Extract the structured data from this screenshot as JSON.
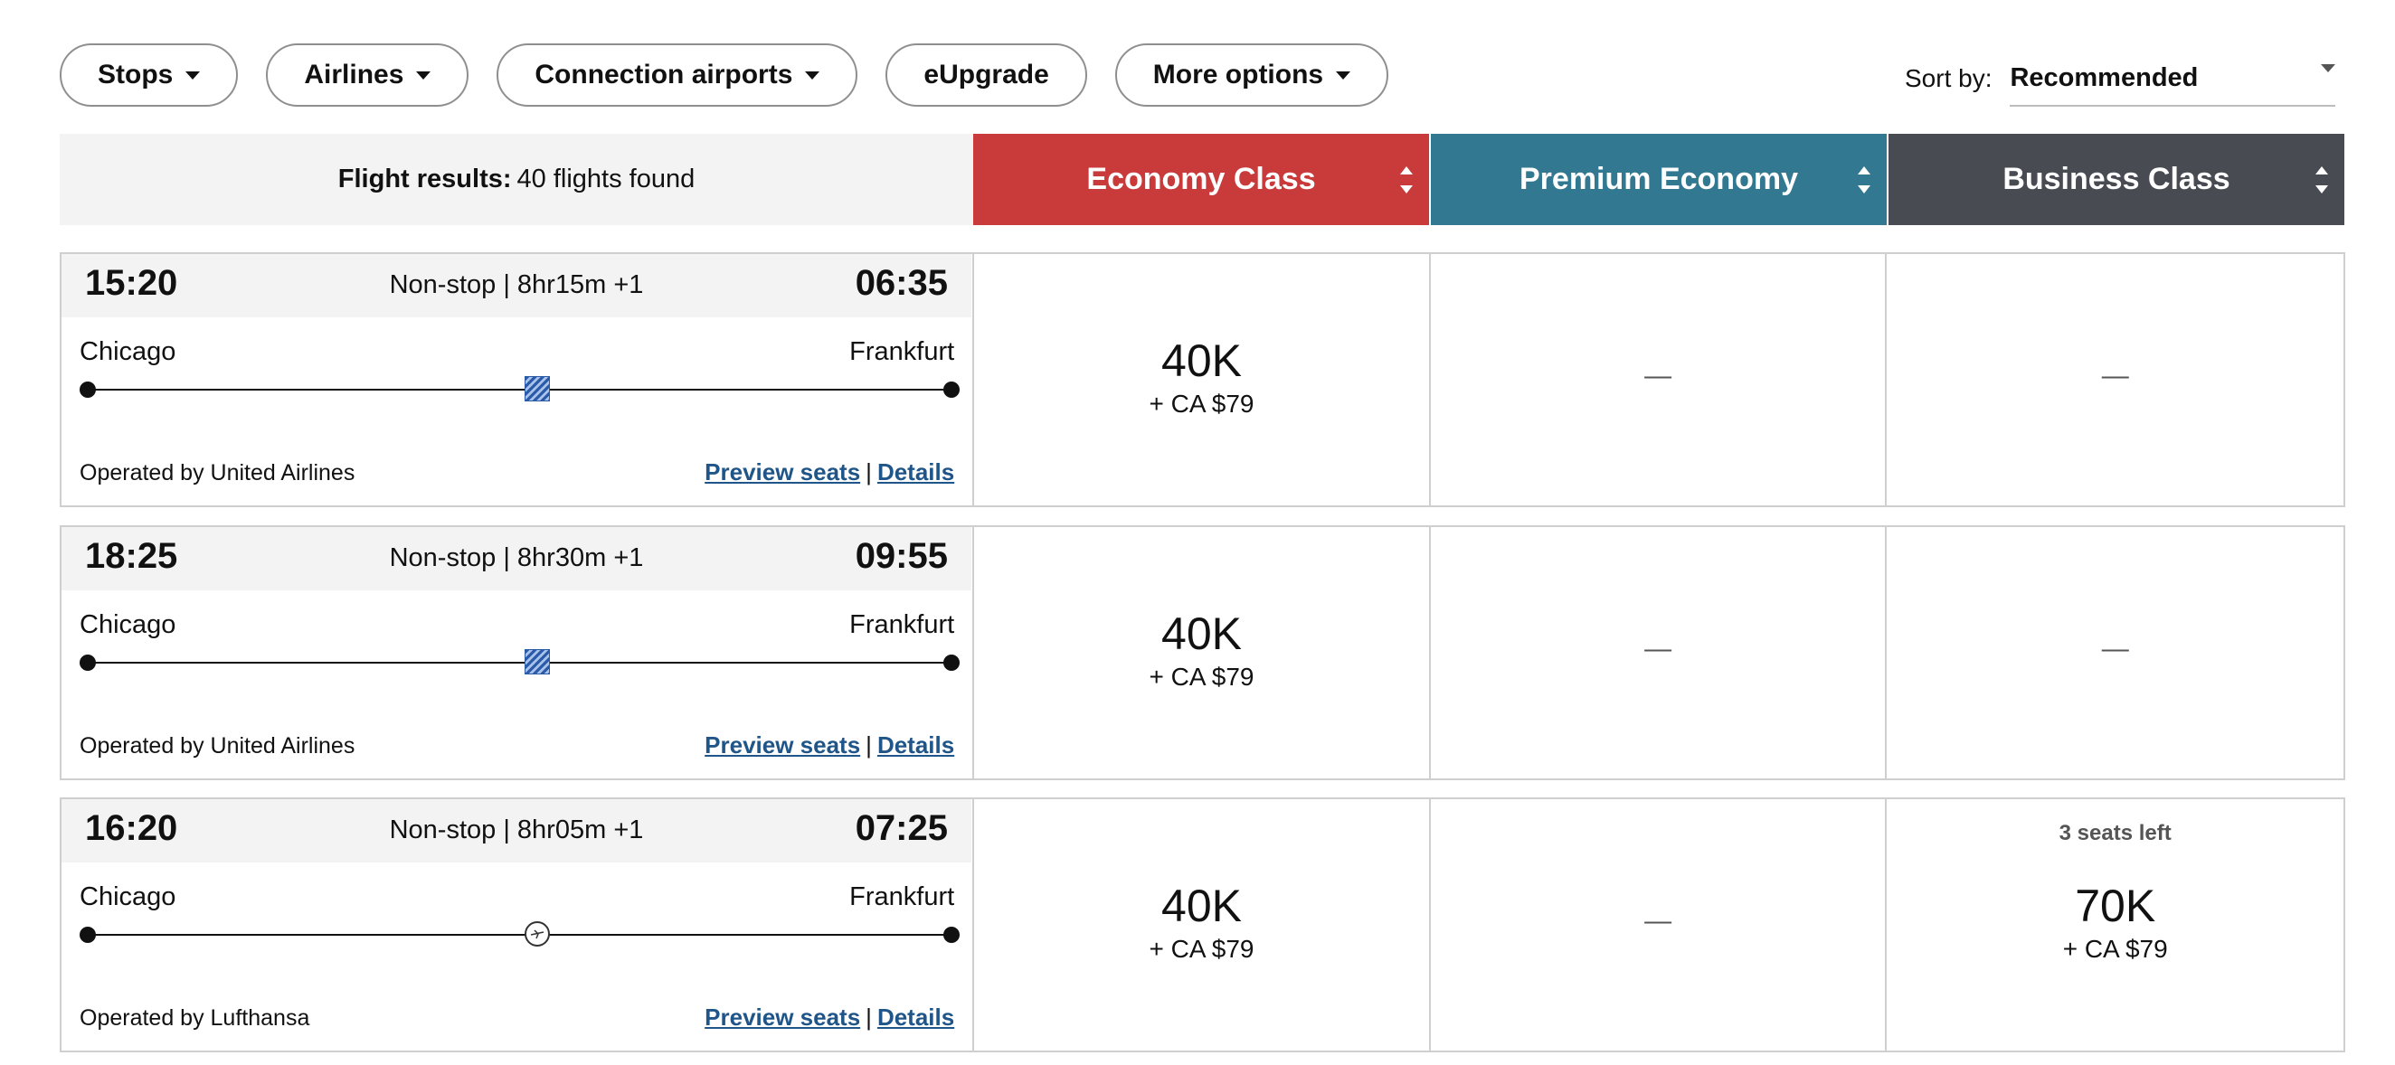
{
  "filters": [
    {
      "label": "Stops",
      "has_caret": true
    },
    {
      "label": "Airlines",
      "has_caret": true
    },
    {
      "label": "Connection airports",
      "has_caret": true
    },
    {
      "label": "eUpgrade",
      "has_caret": false
    },
    {
      "label": "More options",
      "has_caret": true
    }
  ],
  "sort": {
    "label": "Sort by:",
    "value": "Recommended"
  },
  "header": {
    "results_label": "Flight results:",
    "results_count": "40 flights found",
    "cabins": [
      {
        "label": "Economy Class",
        "color": "#c93a3a"
      },
      {
        "label": "Premium Economy",
        "color": "#337891"
      },
      {
        "label": "Business Class",
        "color": "#484c52"
      }
    ]
  },
  "flights": [
    {
      "departure": "15:20",
      "arrival": "06:35",
      "summary": "Non-stop | 8hr15m +1",
      "origin": "Chicago",
      "destination": "Frankfurt",
      "operated_by": "Operated by United Airlines",
      "airline_icon": "united-logo-icon",
      "preview_label": "Preview seats",
      "details_label": "Details",
      "separator": "|",
      "economy": {
        "miles": "40K",
        "tax": "+ CA $79"
      },
      "premium": {
        "dash": "—"
      },
      "business": {
        "dash": "—"
      }
    },
    {
      "departure": "18:25",
      "arrival": "09:55",
      "summary": "Non-stop | 8hr30m +1",
      "origin": "Chicago",
      "destination": "Frankfurt",
      "operated_by": "Operated by United Airlines",
      "airline_icon": "united-logo-icon",
      "preview_label": "Preview seats",
      "details_label": "Details",
      "separator": "|",
      "economy": {
        "miles": "40K",
        "tax": "+ CA $79"
      },
      "premium": {
        "dash": "—"
      },
      "business": {
        "dash": "—"
      }
    },
    {
      "departure": "16:20",
      "arrival": "07:25",
      "summary": "Non-stop | 8hr05m +1",
      "origin": "Chicago",
      "destination": "Frankfurt",
      "operated_by": "Operated by Lufthansa",
      "airline_icon": "lufthansa-logo-icon",
      "preview_label": "Preview seats",
      "details_label": "Details",
      "separator": "|",
      "economy": {
        "miles": "40K",
        "tax": "+ CA $79"
      },
      "premium": {
        "dash": "—"
      },
      "business": {
        "seats_left": "3 seats left",
        "miles": "70K",
        "tax": "+ CA $79"
      }
    }
  ]
}
